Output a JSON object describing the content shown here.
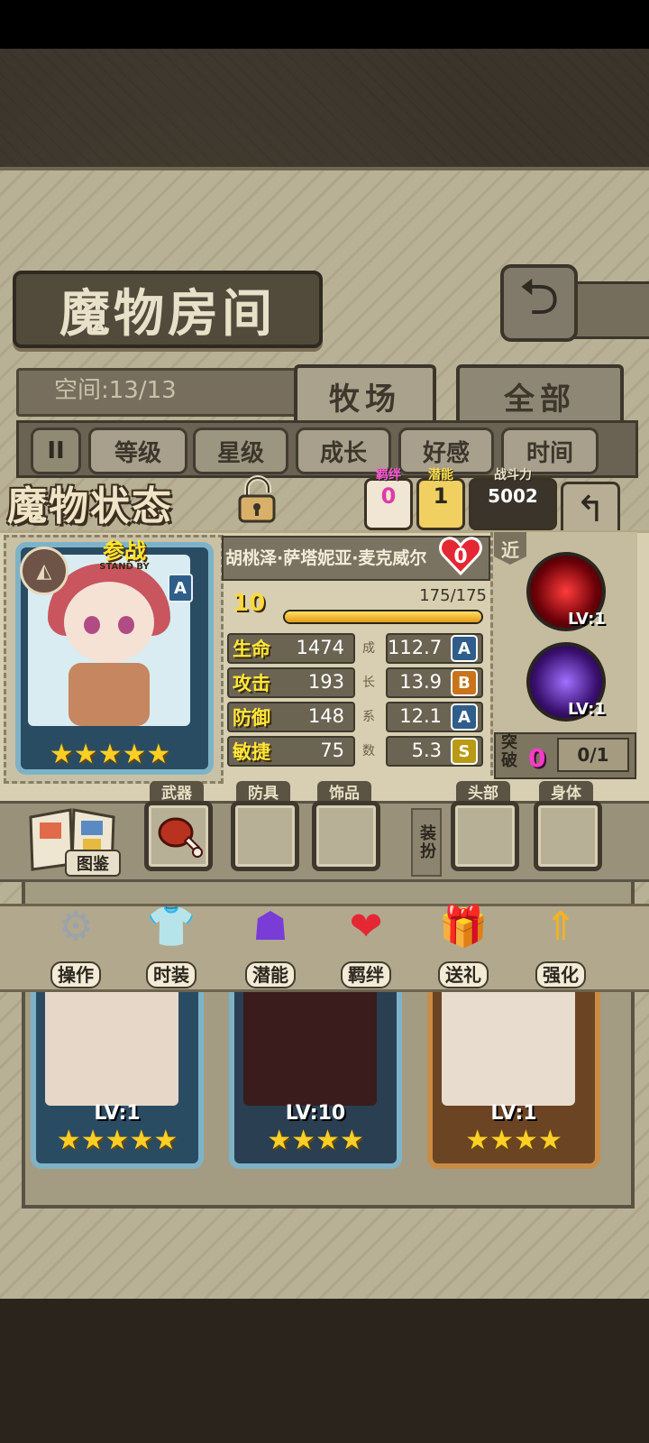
{
  "header": {
    "room_title": "魔物房间",
    "space_label": "空间:13/13",
    "tabs": [
      {
        "label": "牧场"
      },
      {
        "label": "全部"
      }
    ]
  },
  "filters": {
    "pause_glyph": "II",
    "items": [
      {
        "label": "等级"
      },
      {
        "label": "星级"
      },
      {
        "label": "成长"
      },
      {
        "label": "好感"
      },
      {
        "label": "时间"
      }
    ]
  },
  "status": {
    "title": "魔物状态",
    "bond": {
      "label": "羁绊",
      "value": "0"
    },
    "potential": {
      "label": "潜能",
      "value": "1"
    },
    "power": {
      "label": "战斗力",
      "value": "5002"
    }
  },
  "monster": {
    "standby_big": "参战",
    "standby_small": "STAND BY",
    "rank": "A",
    "name": "胡桃泽·萨塔妮亚·麦克威尔",
    "affinity": "0",
    "level": "10",
    "exp_text": "175/175",
    "exp_fraction": 1.0,
    "stars": 5,
    "stats": [
      {
        "label": "生命",
        "value": "1474",
        "growth": "112.7",
        "grade": "A",
        "grade_color": "#2f5e8a"
      },
      {
        "label": "攻击",
        "value": "193",
        "growth": "13.9",
        "grade": "B",
        "grade_color": "#c9741a"
      },
      {
        "label": "防御",
        "value": "148",
        "growth": "12.1",
        "grade": "A",
        "grade_color": "#2f5e8a"
      },
      {
        "label": "敏捷",
        "value": "75",
        "growth": "5.3",
        "grade": "S",
        "grade_color": "#b89a14"
      }
    ],
    "growth_side_chars": [
      "成",
      "长",
      "系",
      "数"
    ]
  },
  "skills": {
    "range_tag": "近",
    "items": [
      {
        "lv": "LV:1",
        "icon": "flame-slash-icon",
        "color": "#b0101a"
      },
      {
        "lv": "LV:1",
        "icon": "shadow-figure-icon",
        "color": "#5b2aa0"
      }
    ],
    "breakthrough_label": "突破",
    "breakthrough_count": "0",
    "breakthrough_progress": "0/1"
  },
  "equipment": {
    "album_label": "图鉴",
    "equip_label": "装扮",
    "slots": [
      {
        "label": "武器",
        "item": "meat-icon"
      },
      {
        "label": "防具",
        "item": ""
      },
      {
        "label": "饰品",
        "item": ""
      },
      {
        "label": "头部",
        "item": ""
      },
      {
        "label": "身体",
        "item": ""
      }
    ]
  },
  "actions": [
    {
      "label": "操作",
      "icon": "gear-icon"
    },
    {
      "label": "时装",
      "icon": "outfit-icon"
    },
    {
      "label": "潜能",
      "icon": "demon-icon"
    },
    {
      "label": "羁绊",
      "icon": "hearts-icon"
    },
    {
      "label": "送礼",
      "icon": "gift-icon"
    },
    {
      "label": "强化",
      "icon": "upgrade-arrows-icon"
    }
  ],
  "gallery": [
    {
      "lv": "LV:1",
      "stars": 5,
      "frame": "#7eb3c7"
    },
    {
      "lv": "LV:10",
      "stars": 4,
      "frame": "#7eb3c7"
    },
    {
      "lv": "LV:1",
      "stars": 4,
      "frame": "#c98c45"
    }
  ],
  "colors": {
    "gold": "#ffcf25",
    "pink_accent": "#ff3ac8"
  }
}
